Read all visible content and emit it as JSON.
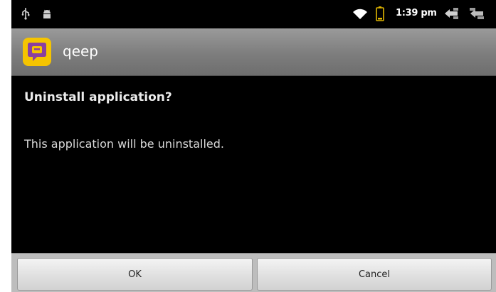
{
  "status_bar": {
    "time": "1:39 pm",
    "icons": [
      "usb-icon",
      "android-debug-icon",
      "wifi-icon",
      "battery-icon",
      "back-icon",
      "menu-icon"
    ]
  },
  "app": {
    "name": "qeep",
    "icon": "qeep-app-icon",
    "accent_color": "#8a3fa0",
    "icon_bg_color": "#f5c400"
  },
  "dialog": {
    "title": "Uninstall application?",
    "message": "This application will be uninstalled.",
    "ok_label": "OK",
    "cancel_label": "Cancel"
  }
}
